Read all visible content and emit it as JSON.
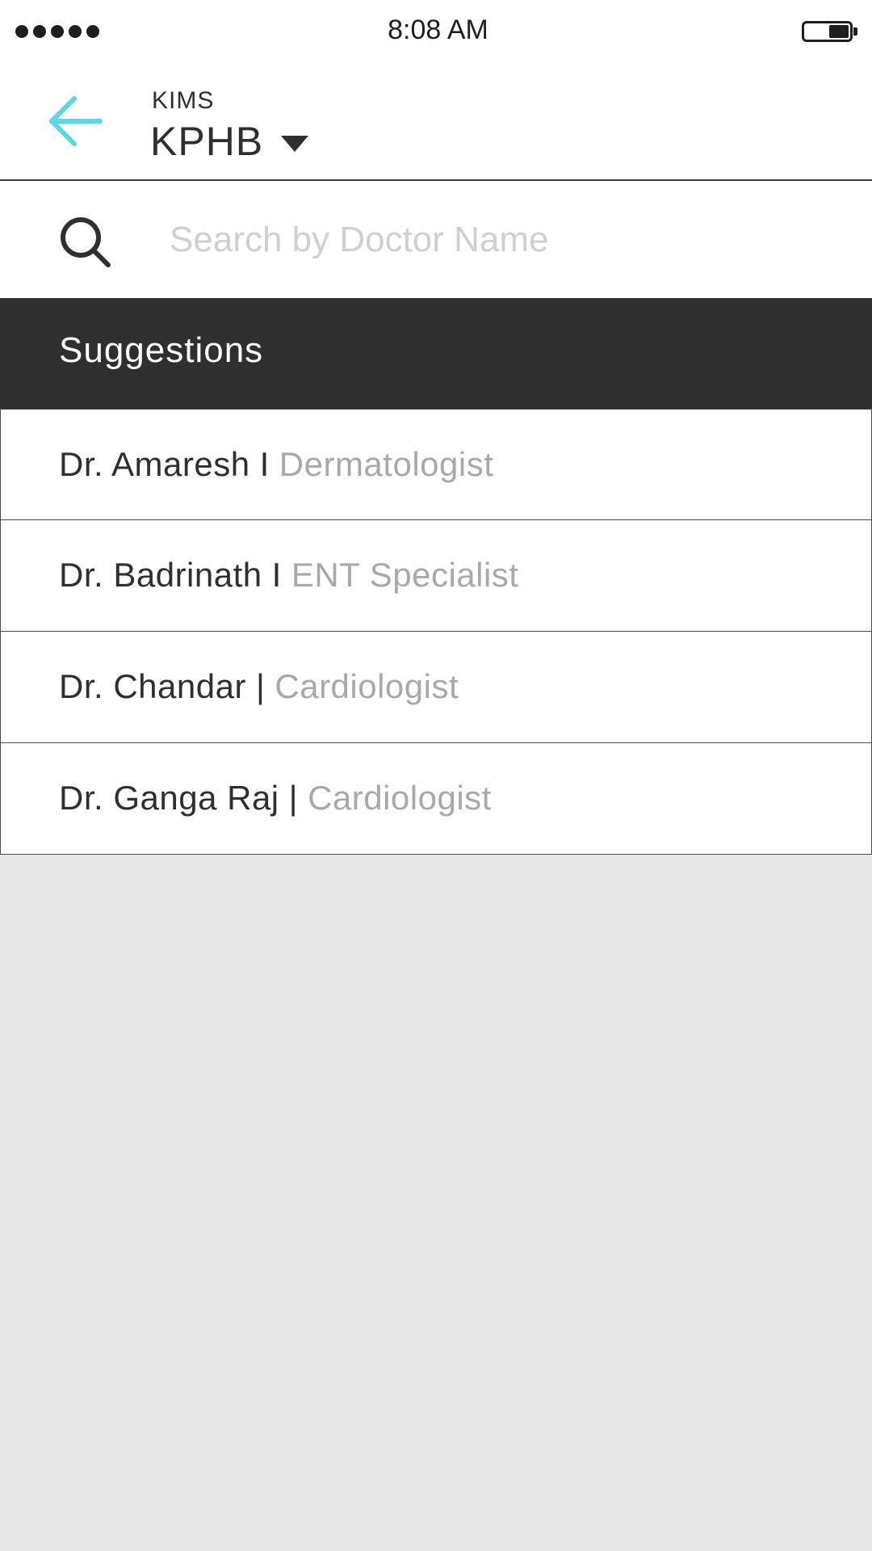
{
  "status_bar": {
    "time": "8:08 AM",
    "signal_icon": "signal-dots-icon",
    "battery_icon": "battery-icon"
  },
  "header": {
    "back_icon": "arrow-left-icon",
    "subtitle": "KIMS",
    "location": "KPHB",
    "dropdown_icon": "caret-down-icon",
    "accent_color": "#5dd6e6"
  },
  "search": {
    "icon": "search-icon",
    "placeholder": "Search by Doctor Name",
    "value": ""
  },
  "suggestions": {
    "title": "Suggestions",
    "items": [
      {
        "name": "Dr. Amaresh",
        "separator": "I",
        "specialty": "Dermatologist"
      },
      {
        "name": "Dr. Badrinath",
        "separator": "I",
        "specialty": "ENT Specialist"
      },
      {
        "name": "Dr. Chandar",
        "separator": "|",
        "specialty": "Cardiologist"
      },
      {
        "name": "Dr. Ganga Raj",
        "separator": "|",
        "specialty": "Cardiologist"
      }
    ]
  },
  "colors": {
    "suggestions_header_bg": "#2f2f2f",
    "background": "#e8e8e8",
    "specialty_text": "#a8a8a8"
  }
}
